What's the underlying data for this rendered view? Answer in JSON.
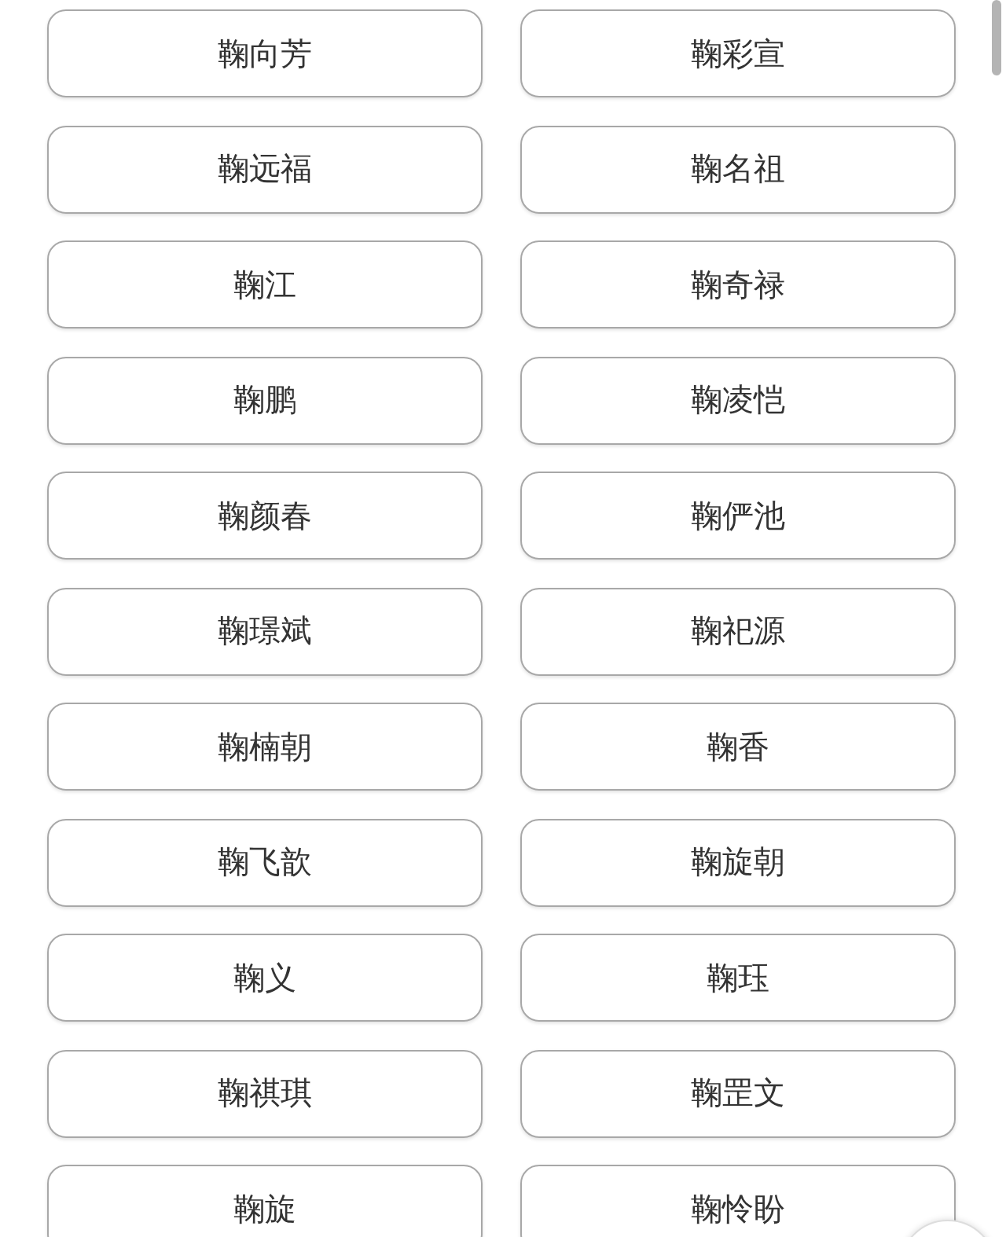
{
  "names": [
    "鞠向芳",
    "鞠彩宣",
    "鞠远福",
    "鞠名祖",
    "鞠江",
    "鞠奇禄",
    "鞠鹏",
    "鞠凌恺",
    "鞠颜春",
    "鞠俨池",
    "鞠璟斌",
    "鞠祀源",
    "鞠楠朝",
    "鞠香",
    "鞠飞歆",
    "鞠旋朝",
    "鞠义",
    "鞠珏",
    "鞠祺琪",
    "鞠罡文",
    "鞠旋",
    "鞠怜盼"
  ]
}
